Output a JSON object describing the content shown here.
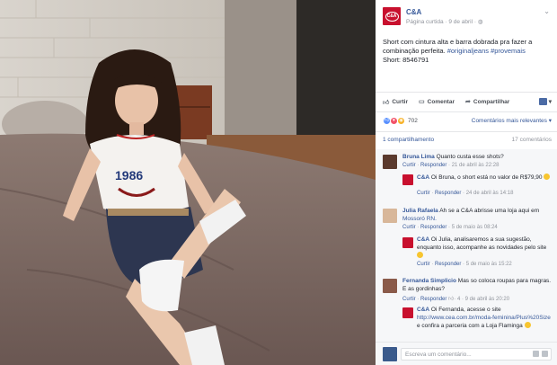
{
  "post": {
    "page_name": "C&A",
    "logo_text": "C&A",
    "meta": "Página curtida · 9 de abril · ",
    "text": "Short com cintura alta e barra dobrada pra fazer a combinação perfeita. ",
    "hashtags": "#originaljeans #provemais",
    "product": "Short: 8546791"
  },
  "actions": {
    "like": "Curtir",
    "comment": "Comentar",
    "share": "Compartilhar"
  },
  "reactions": {
    "count": "702",
    "sort": "Comentários mais relevantes ▾"
  },
  "counts": {
    "shares": "1 compartilhamento",
    "comments": "17 comentários"
  },
  "comments": [
    {
      "author": "Bruna Lima",
      "text": "Quanto custa esse shots?",
      "like": "Curtir",
      "reply": "Responder",
      "time": "· 21 de abril às 22:28"
    },
    {
      "author": "C&A",
      "text": "Oi Bruna, o short está no valor de R$79,90",
      "like": "Curtir",
      "reply": "Responder",
      "time": "· 24 de abril às 14:18"
    },
    {
      "author": "Julia Rafaela",
      "text": "Ah se a C&A abrisse uma loja aqui em ",
      "mention": "Mossoró RN.",
      "like": "Curtir",
      "reply": "Responder",
      "time": "· 5 de maio às 08:24"
    },
    {
      "author": "C&A",
      "text": "Oi Julia, analisaremos a sua sugestão, enquanto isso, acompanhe as novidades pelo site",
      "like": "Curtir",
      "reply": "Responder",
      "time": "· 5 de maio às 15:22"
    },
    {
      "author": "Fernanda Simplicio",
      "text": "Mas so coloca roupas para magras. E as gordinhas?",
      "like": "Curtir",
      "reply": "Responder",
      "likes": "· 4",
      "time": "· 9 de abril às 20:20"
    },
    {
      "author": "C&A",
      "text": "Oi Fernanda, acesse o site ",
      "link": "http://www.cea.com.br/moda-feminina/Plus%20Size",
      "text2": " e confira a parceria com a Loja Flaminga"
    }
  ],
  "composer": {
    "placeholder": "Escreva um comentário..."
  },
  "colors": {
    "brand": "#c8102e",
    "link": "#365899",
    "muted": "#90949c"
  }
}
